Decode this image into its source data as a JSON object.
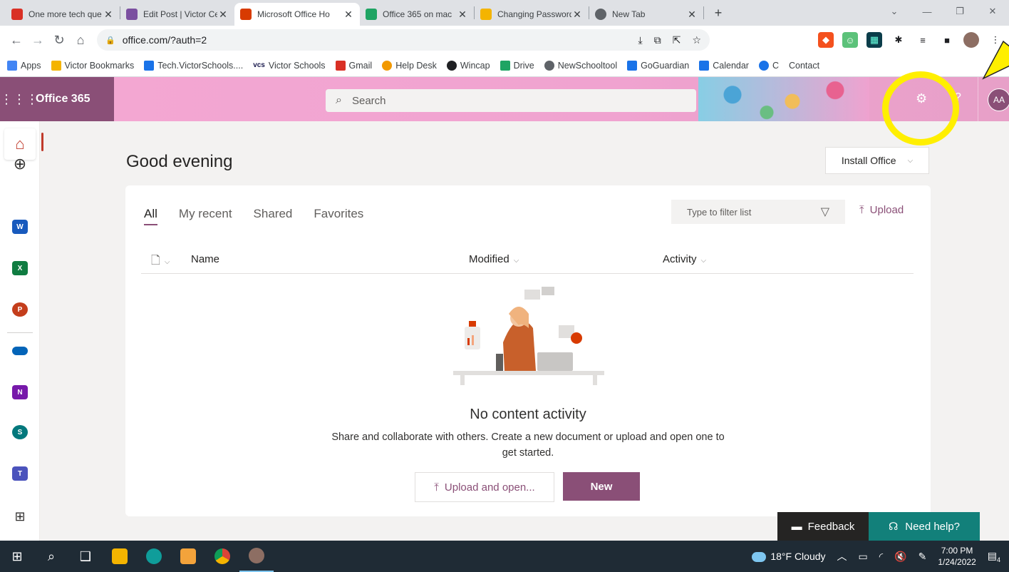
{
  "browser": {
    "tabs": [
      {
        "title": "One more tech que",
        "fav_color": "#d93025"
      },
      {
        "title": "Edit Post | Victor Ce",
        "fav_color": "#7b4fa0"
      },
      {
        "title": "Microsoft Office Ho",
        "fav_color": "#d83b01"
      },
      {
        "title": "Office 365 on mac",
        "fav_color": "#1fa463"
      },
      {
        "title": "Changing Password",
        "fav_color": "#f4b400"
      },
      {
        "title": "New Tab",
        "fav_color": "#5f6368"
      }
    ],
    "url": "office.com/?auth=2",
    "bookmarks": [
      {
        "label": "Apps",
        "color": "#4285f4"
      },
      {
        "label": "Victor Bookmarks",
        "color": "#f4b400"
      },
      {
        "label": "Tech.VictorSchools....",
        "color": "#1a73e8"
      },
      {
        "label": "Victor Schools",
        "color": "#1a1a4e"
      },
      {
        "label": "Gmail",
        "color": "#d93025"
      },
      {
        "label": "Help Desk",
        "color": "#f29900"
      },
      {
        "label": "Wincap",
        "color": "#202124"
      },
      {
        "label": "Drive",
        "color": "#1fa463"
      },
      {
        "label": "NewSchooltool",
        "color": "#5f6368"
      },
      {
        "label": "GoGuardian",
        "color": "#1a73e8"
      },
      {
        "label": "Calendar",
        "color": "#1a73e8"
      },
      {
        "label": "C",
        "color": "#1a73e8"
      },
      {
        "label": "Contact",
        "color": "#ffffff"
      }
    ]
  },
  "office": {
    "brand": "Office 365",
    "search_placeholder": "Search",
    "avatar_initials": "AA",
    "greeting": "Good evening",
    "install_label": "Install Office",
    "tabs": [
      "All",
      "My recent",
      "Shared",
      "Favorites"
    ],
    "filter_placeholder": "Type to filter list",
    "upload_label": "Upload",
    "columns": {
      "name": "Name",
      "modified": "Modified",
      "activity": "Activity"
    },
    "empty_title": "No content activity",
    "empty_desc": "Share and collaborate with others. Create a new document or upload and open one to get started.",
    "upload_open_label": "Upload and open...",
    "new_label": "New",
    "feedback_label": "Feedback",
    "help_label": "Need help?",
    "accent": "#8a4f77"
  },
  "rail_apps": [
    {
      "name": "W",
      "color": "#185abd"
    },
    {
      "name": "X",
      "color": "#107c41"
    },
    {
      "name": "P",
      "color": "#c43e1c"
    },
    {
      "name": "",
      "color": "#0364b8"
    },
    {
      "name": "N",
      "color": "#7719aa"
    },
    {
      "name": "S",
      "color": "#03787c"
    },
    {
      "name": "T",
      "color": "#4b53bc"
    }
  ],
  "taskbar": {
    "weather": "18°F Cloudy",
    "time": "7:00 PM",
    "date": "1/24/2022",
    "notifications": "4"
  }
}
